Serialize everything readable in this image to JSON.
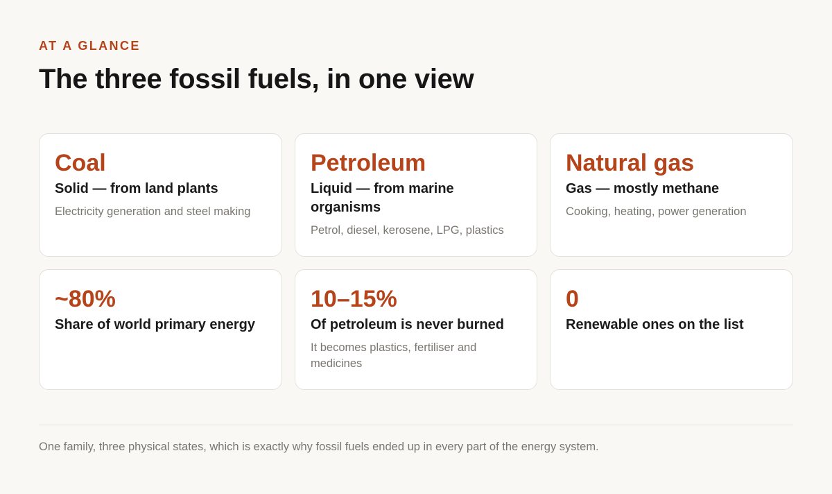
{
  "header": {
    "eyebrow": "AT A GLANCE",
    "title": "The three fossil fuels, in one view"
  },
  "cards": [
    {
      "heading": "Coal",
      "subtitle": "Solid — from land plants",
      "note": "Electricity generation and steel making"
    },
    {
      "heading": "Petroleum",
      "subtitle": "Liquid — from marine organisms",
      "note": "Petrol, diesel, kerosene, LPG, plastics"
    },
    {
      "heading": "Natural gas",
      "subtitle": "Gas — mostly methane",
      "note": "Cooking, heating, power generation"
    },
    {
      "heading": "~80%",
      "subtitle": "Share of world primary energy",
      "note": ""
    },
    {
      "heading": "10–15%",
      "subtitle": "Of petroleum is never burned",
      "note": "It becomes plastics, fertiliser and medicines"
    },
    {
      "heading": "0",
      "subtitle": "Renewable ones on the list",
      "note": ""
    }
  ],
  "footer": {
    "text": "One family, three physical states, which is exactly why fossil fuels ended up in every part of the energy system."
  },
  "colors": {
    "accent": "#b5441b",
    "background": "#f9f8f5",
    "card": "#ffffff",
    "muted_text": "#7a7770"
  }
}
